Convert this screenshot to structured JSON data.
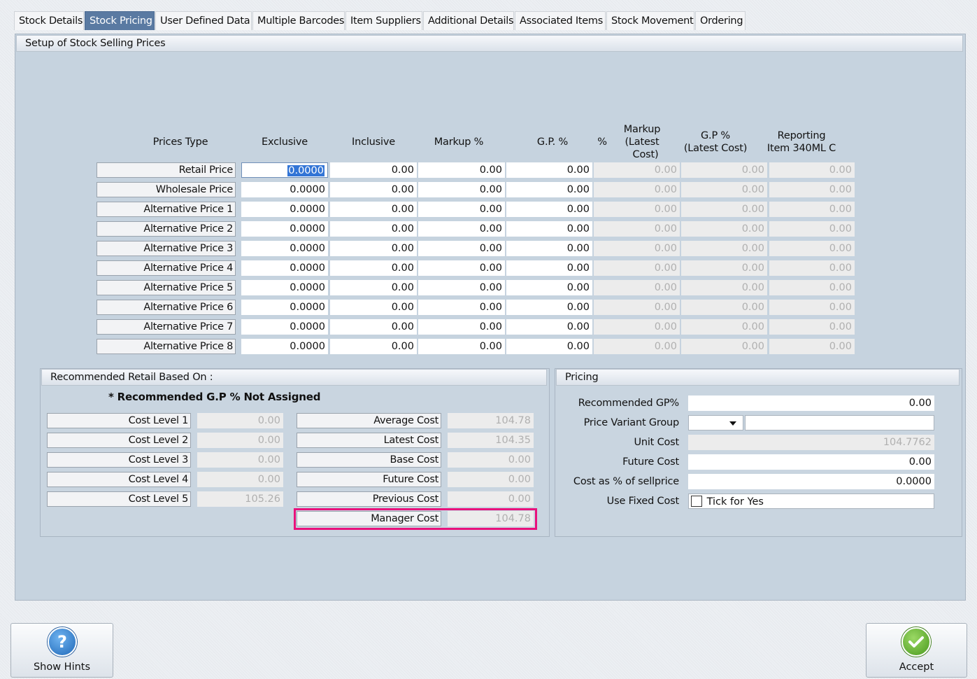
{
  "tabs": [
    {
      "label": "Stock Details",
      "active": false
    },
    {
      "label": "Stock Pricing",
      "active": true
    },
    {
      "label": "User Defined Data",
      "active": false
    },
    {
      "label": "Multiple Barcodes",
      "active": false
    },
    {
      "label": "Item Suppliers",
      "active": false
    },
    {
      "label": "Additional Details",
      "active": false
    },
    {
      "label": "Associated Items",
      "active": false
    },
    {
      "label": "Stock Movement",
      "active": false
    },
    {
      "label": "Ordering",
      "active": false
    }
  ],
  "section_title": "Setup of Stock Selling Prices",
  "price_table": {
    "headers": {
      "prices_type": "Prices Type",
      "exclusive": "Exclusive",
      "inclusive": "Inclusive",
      "markup": "Markup %",
      "gp": "G.P. %",
      "pct": "%",
      "markup_latest_1": "Markup",
      "markup_latest_2": "(Latest",
      "markup_latest_3": "Cost)",
      "gp_latest_1": "G.P %",
      "gp_latest_2": "(Latest Cost)",
      "reporting_1": "Reporting",
      "reporting_2": "Item 340ML C"
    },
    "rows": [
      {
        "label": "Retail Price",
        "exclusive": "0.0000",
        "inclusive": "0.00",
        "markup": "0.00",
        "gp": "0.00",
        "markup_latest": "0.00",
        "gp_latest": "0.00",
        "reporting": "0.00"
      },
      {
        "label": "Wholesale Price",
        "exclusive": "0.0000",
        "inclusive": "0.00",
        "markup": "0.00",
        "gp": "0.00",
        "markup_latest": "0.00",
        "gp_latest": "0.00",
        "reporting": "0.00"
      },
      {
        "label": "Alternative Price 1",
        "exclusive": "0.0000",
        "inclusive": "0.00",
        "markup": "0.00",
        "gp": "0.00",
        "markup_latest": "0.00",
        "gp_latest": "0.00",
        "reporting": "0.00"
      },
      {
        "label": "Alternative Price 2",
        "exclusive": "0.0000",
        "inclusive": "0.00",
        "markup": "0.00",
        "gp": "0.00",
        "markup_latest": "0.00",
        "gp_latest": "0.00",
        "reporting": "0.00"
      },
      {
        "label": "Alternative Price 3",
        "exclusive": "0.0000",
        "inclusive": "0.00",
        "markup": "0.00",
        "gp": "0.00",
        "markup_latest": "0.00",
        "gp_latest": "0.00",
        "reporting": "0.00"
      },
      {
        "label": "Alternative Price 4",
        "exclusive": "0.0000",
        "inclusive": "0.00",
        "markup": "0.00",
        "gp": "0.00",
        "markup_latest": "0.00",
        "gp_latest": "0.00",
        "reporting": "0.00"
      },
      {
        "label": "Alternative Price 5",
        "exclusive": "0.0000",
        "inclusive": "0.00",
        "markup": "0.00",
        "gp": "0.00",
        "markup_latest": "0.00",
        "gp_latest": "0.00",
        "reporting": "0.00"
      },
      {
        "label": "Alternative Price 6",
        "exclusive": "0.0000",
        "inclusive": "0.00",
        "markup": "0.00",
        "gp": "0.00",
        "markup_latest": "0.00",
        "gp_latest": "0.00",
        "reporting": "0.00"
      },
      {
        "label": "Alternative Price 7",
        "exclusive": "0.0000",
        "inclusive": "0.00",
        "markup": "0.00",
        "gp": "0.00",
        "markup_latest": "0.00",
        "gp_latest": "0.00",
        "reporting": "0.00"
      },
      {
        "label": "Alternative Price 8",
        "exclusive": "0.0000",
        "inclusive": "0.00",
        "markup": "0.00",
        "gp": "0.00",
        "markup_latest": "0.00",
        "gp_latest": "0.00",
        "reporting": "0.00"
      }
    ]
  },
  "recommended": {
    "title": "Recommended Retail Based On :",
    "note": "* Recommended G.P % Not Assigned",
    "cost_levels": [
      {
        "label": "Cost Level 1",
        "value": "0.00"
      },
      {
        "label": "Cost Level 2",
        "value": "0.00"
      },
      {
        "label": "Cost Level 3",
        "value": "0.00"
      },
      {
        "label": "Cost Level 4",
        "value": "0.00"
      },
      {
        "label": "Cost Level 5",
        "value": "105.26"
      }
    ],
    "costs": [
      {
        "label": "Average Cost",
        "value": "104.78"
      },
      {
        "label": "Latest Cost",
        "value": "104.35"
      },
      {
        "label": "Base Cost",
        "value": "0.00"
      },
      {
        "label": "Future Cost",
        "value": "0.00"
      },
      {
        "label": "Previous Cost",
        "value": "0.00"
      },
      {
        "label": "Manager Cost",
        "value": "104.78"
      }
    ],
    "highlight_color": "#e8127c"
  },
  "pricing": {
    "title": "Pricing",
    "recommended_gp": {
      "label": "Recommended GP%",
      "value": "0.00"
    },
    "price_variant_group": {
      "label": "Price Variant Group",
      "value": "",
      "text": ""
    },
    "unit_cost": {
      "label": "Unit Cost",
      "value": "104.7762"
    },
    "future_cost": {
      "label": "Future Cost",
      "value": "0.00"
    },
    "cost_pct": {
      "label": "Cost as % of sellprice",
      "value": "0.0000"
    },
    "use_fixed_cost": {
      "label": "Use Fixed Cost",
      "checkbox_label": "Tick for Yes",
      "checked": false
    }
  },
  "buttons": {
    "hints": {
      "label": "Show Hints",
      "icon": "help-icon",
      "color": "#2c78c8"
    },
    "accept": {
      "label": "Accept",
      "icon": "check-icon",
      "color": "#5fae2d"
    }
  }
}
